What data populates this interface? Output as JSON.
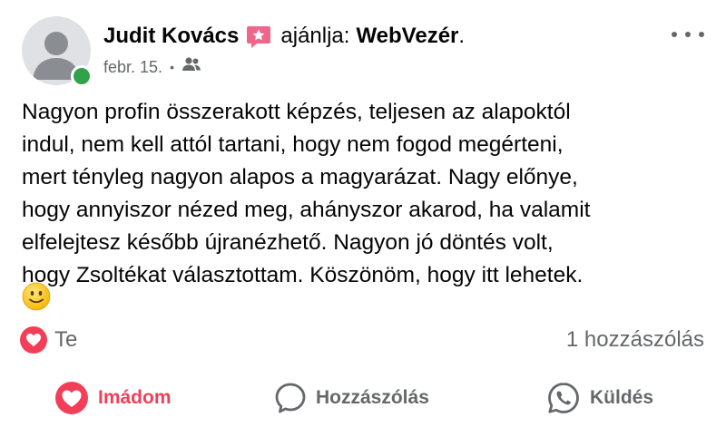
{
  "post": {
    "author": "Judit Kovács",
    "recommends_label": "ajánlja:",
    "page_name": "WebVezér",
    "page_name_suffix": ".",
    "date": "febr. 15.",
    "separator": "•",
    "audience_icon": "friends-icon",
    "text": "Nagyon profin összerakott képzés, teljesen az alapoktól\nindul, nem kell attól tartani, hogy nem fogod megérteni,\nmert tényleg nagyon alapos a magyarázat. Nagy előnye,\nhogy annyiszor nézed meg, ahányszor akarod, ha valamit\nelfelejtesz később újranézhető. Nagyon jó döntés volt,\nhogy Zsoltékat választottam. Köszönöm, hogy itt lehetek.",
    "emoji": "slightly-smiling-face"
  },
  "reactions": {
    "icon": "love-reaction-icon",
    "label": "Te",
    "comments_count_label": "1 hozzászólás"
  },
  "actions": {
    "love_label": "Imádom",
    "comment_label": "Hozzászólás",
    "send_label": "Küldés"
  },
  "colors": {
    "love": "#f33e58",
    "secondary_text": "#65676b",
    "online": "#31a24c",
    "avatar_bg": "#dfe1e5",
    "badge": "#f0668b"
  }
}
